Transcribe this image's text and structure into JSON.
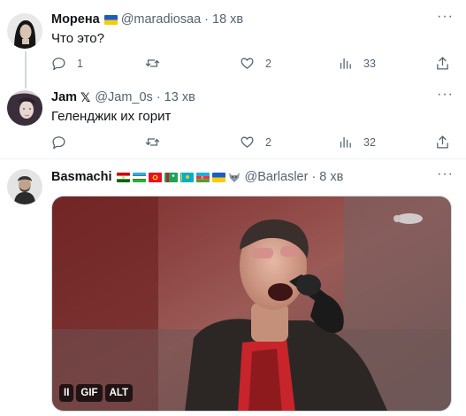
{
  "tweets": [
    {
      "name": "Морена",
      "handle": "@maradiosaa",
      "separator": "·",
      "time": "18 хв",
      "text": "Что это?",
      "replies": "1",
      "retweets": "",
      "likes": "2",
      "views": "33"
    },
    {
      "name": "Jam",
      "x_logo": "𝕏",
      "handle": "@Jam_0s",
      "separator": "·",
      "time": "13 хв",
      "text": "Геленджик их горит",
      "replies": "",
      "retweets": "",
      "likes": "2",
      "views": "32"
    },
    {
      "name": "Basmachi",
      "handle": "@Barlasler",
      "separator": "·",
      "time": "8 хв",
      "media": {
        "pause_label": "II",
        "gif_label": "GIF",
        "alt_label": "ALT"
      }
    }
  ],
  "colors": {
    "text_primary": "#0f1419",
    "text_secondary": "#536471",
    "thread_line": "#cfd9de",
    "divider": "#eff3f4"
  }
}
